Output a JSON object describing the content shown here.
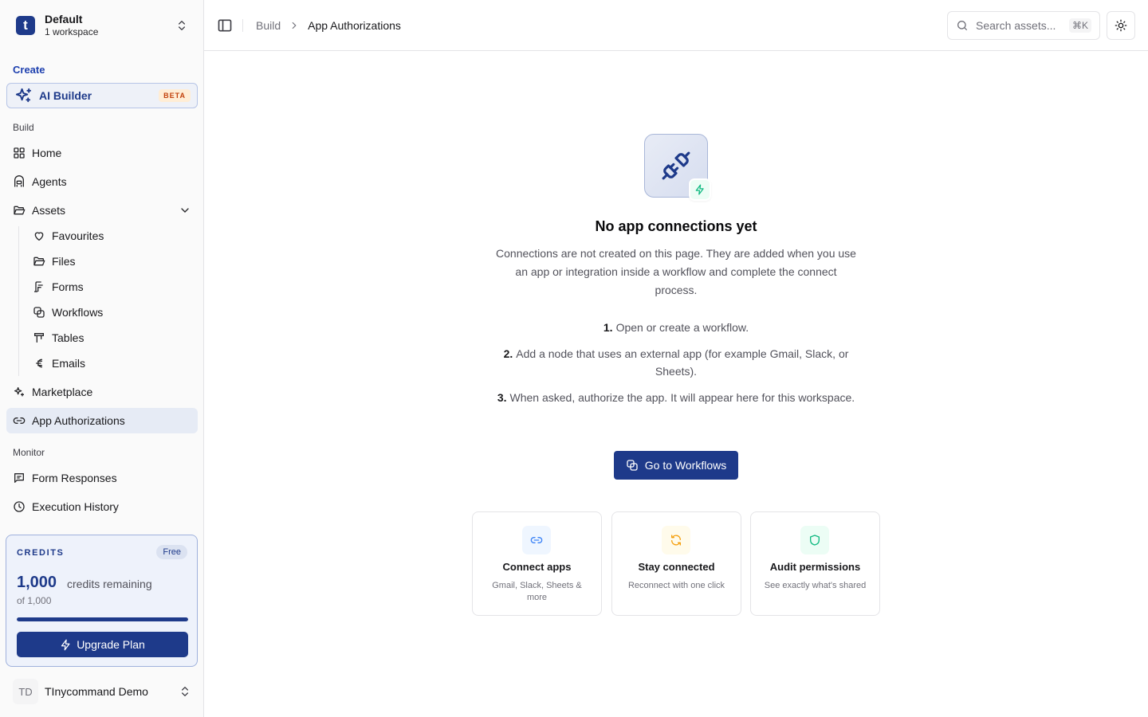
{
  "workspace": {
    "logo_letter": "t",
    "name": "Default",
    "subtitle": "1 workspace"
  },
  "sidebar": {
    "create_label": "Create",
    "ai_builder": {
      "label": "AI Builder",
      "badge": "BETA"
    },
    "build_label": "Build",
    "build_items": [
      {
        "label": "Home",
        "icon": "grid-icon"
      },
      {
        "label": "Agents",
        "icon": "agents-icon"
      },
      {
        "label": "Assets",
        "icon": "folder-open-icon",
        "expanded": true
      }
    ],
    "asset_items": [
      {
        "label": "Favourites",
        "icon": "heart-icon"
      },
      {
        "label": "Files",
        "icon": "folder-icon"
      },
      {
        "label": "Forms",
        "icon": "form-icon"
      },
      {
        "label": "Workflows",
        "icon": "workflow-icon"
      },
      {
        "label": "Tables",
        "icon": "table-icon"
      },
      {
        "label": "Emails",
        "icon": "email-icon"
      }
    ],
    "other_items": [
      {
        "label": "Marketplace",
        "icon": "sparkles-icon"
      },
      {
        "label": "App Authorizations",
        "icon": "link-icon",
        "active": true
      }
    ],
    "monitor_label": "Monitor",
    "monitor_items": [
      {
        "label": "Form Responses",
        "icon": "message-icon"
      },
      {
        "label": "Execution History",
        "icon": "clock-icon"
      }
    ],
    "credits": {
      "title": "CREDITS",
      "plan": "Free",
      "remaining": "1,000",
      "remaining_label": "credits remaining",
      "total": "of 1,000",
      "fraction": 1.0,
      "upgrade_label": "Upgrade Plan"
    },
    "user": {
      "initials": "TD",
      "name": "TInycommand Demo"
    }
  },
  "header": {
    "breadcrumb": [
      "Build",
      "App Authorizations"
    ],
    "search_placeholder": "Search assets...",
    "search_shortcut": "⌘K"
  },
  "main": {
    "title": "No app connections yet",
    "description": "Connections are not created on this page. They are added when you use an app or integration inside a workflow and complete the connect process.",
    "steps": [
      {
        "num": "1.",
        "text": "Open or create a workflow."
      },
      {
        "num": "2.",
        "text": "Add a node that uses an external app (for example Gmail, Slack, or Sheets)."
      },
      {
        "num": "3.",
        "text": "When asked, authorize the app. It will appear here for this workspace."
      }
    ],
    "cta_label": "Go to Workflows",
    "cards": [
      {
        "title": "Connect apps",
        "desc": "Gmail, Slack, Sheets & more",
        "icon": "link-icon",
        "color": "#3b82f6",
        "bg": "#eff6ff"
      },
      {
        "title": "Stay connected",
        "desc": "Reconnect with one click",
        "icon": "refresh-icon",
        "color": "#f59e0b",
        "bg": "#fffbeb"
      },
      {
        "title": "Audit permissions",
        "desc": "See exactly what's shared",
        "icon": "shield-icon",
        "color": "#10b981",
        "bg": "#ecfdf5"
      }
    ]
  },
  "colors": {
    "brand": "#1e3a8a",
    "active_bg": "#e6ebf5",
    "beta": "#c2410c"
  }
}
